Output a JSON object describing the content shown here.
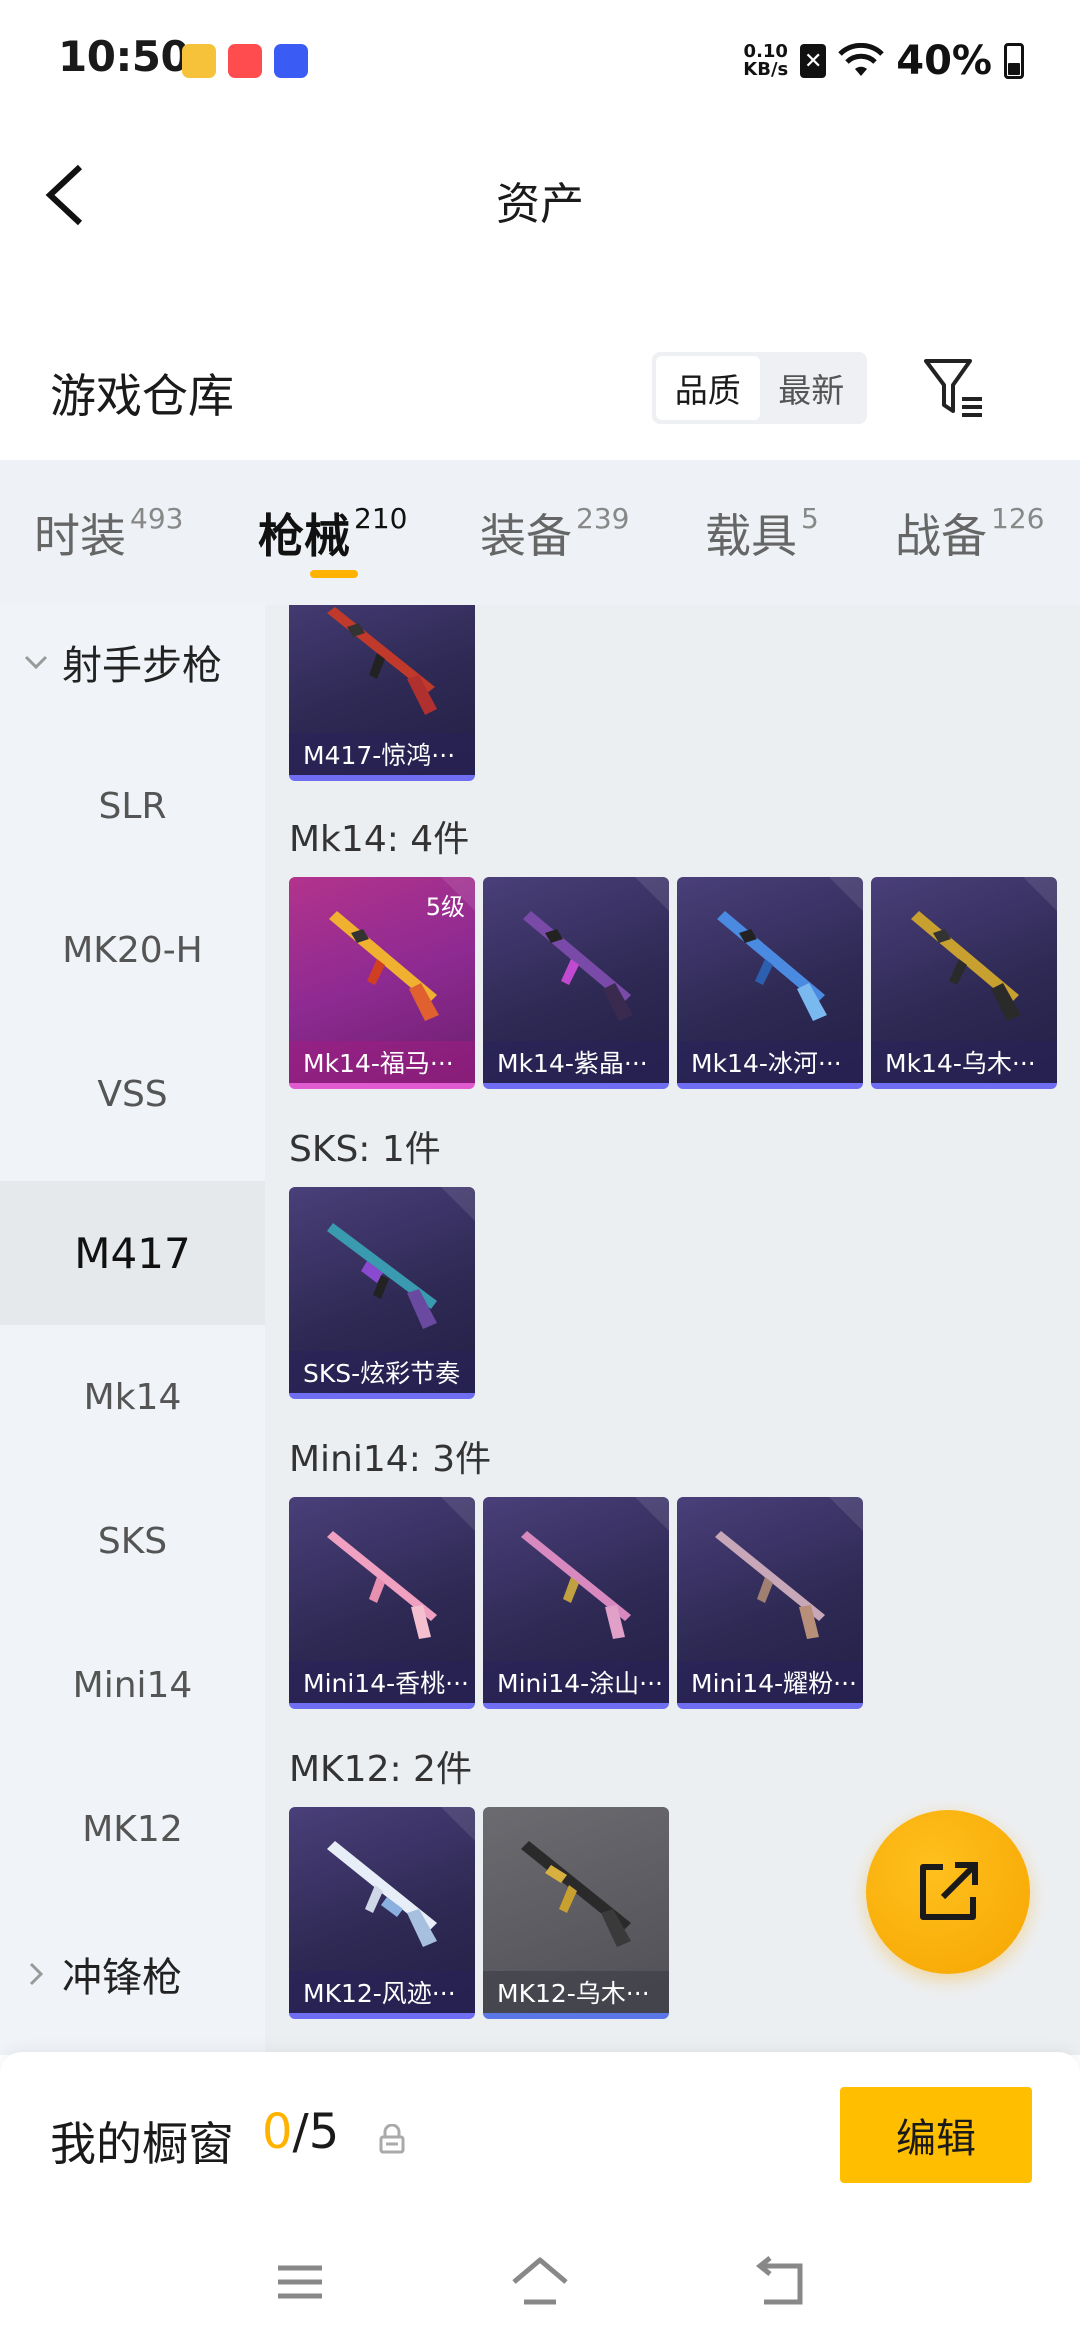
{
  "status_bar": {
    "time": "10:50",
    "app_icons": [
      {
        "name": "game-app-icon",
        "color": "#f5c23a"
      },
      {
        "name": "huawei-app-icon",
        "color": "#ff4d4f"
      },
      {
        "name": "vivo-app-icon",
        "color": "#3a5cf5"
      }
    ],
    "net_speed_value": "0.10",
    "net_speed_unit": "KB/s",
    "battery": "40%",
    "battery_level": 0.4
  },
  "header": {
    "title": "资产"
  },
  "section": {
    "title": "游戏仓库",
    "sort_options": [
      "品质",
      "最新"
    ],
    "sort_selected": "品质"
  },
  "tabs": [
    {
      "label": "时装",
      "count": "493"
    },
    {
      "label": "枪械",
      "count": "210",
      "active": true
    },
    {
      "label": "装备",
      "count": "239"
    },
    {
      "label": "载具",
      "count": "5"
    },
    {
      "label": "战备",
      "count": "126"
    }
  ],
  "sidebar": {
    "group_expanded": "射手步枪",
    "items": [
      "SLR",
      "MK20-H",
      "VSS",
      "M417",
      "Mk14",
      "SKS",
      "Mini14",
      "MK12"
    ],
    "active_item": "M417",
    "group_collapsed": "冲锋枪"
  },
  "content": {
    "m417_card": {
      "name": "M417-惊鸿···"
    },
    "groups": [
      {
        "label": "Mk14: 4件",
        "cards": [
          {
            "name": "Mk14-福马···",
            "level": "5级",
            "style": "pink"
          },
          {
            "name": "Mk14-紫晶···"
          },
          {
            "name": "Mk14-冰河···"
          },
          {
            "name": "Mk14-乌木···"
          }
        ]
      },
      {
        "label": "SKS: 1件",
        "cards": [
          {
            "name": "SKS-炫彩节奏"
          }
        ]
      },
      {
        "label": "Mini14: 3件",
        "cards": [
          {
            "name": "Mini14-香桃···"
          },
          {
            "name": "Mini14-涂山···"
          },
          {
            "name": "Mini14-耀粉···"
          }
        ]
      },
      {
        "label": "MK12: 2件",
        "cards": [
          {
            "name": "MK12-风迹···"
          },
          {
            "name": "MK12-乌木···",
            "style": "gray"
          }
        ]
      }
    ]
  },
  "showcase": {
    "label": "我的橱窗",
    "current": "0",
    "total": "/5",
    "edit_label": "编辑"
  },
  "colors": {
    "accent": "#ffb300",
    "card_purple": "#2f2a55",
    "card_pink": "#8e2a92",
    "card_border": "#6f6df2"
  }
}
